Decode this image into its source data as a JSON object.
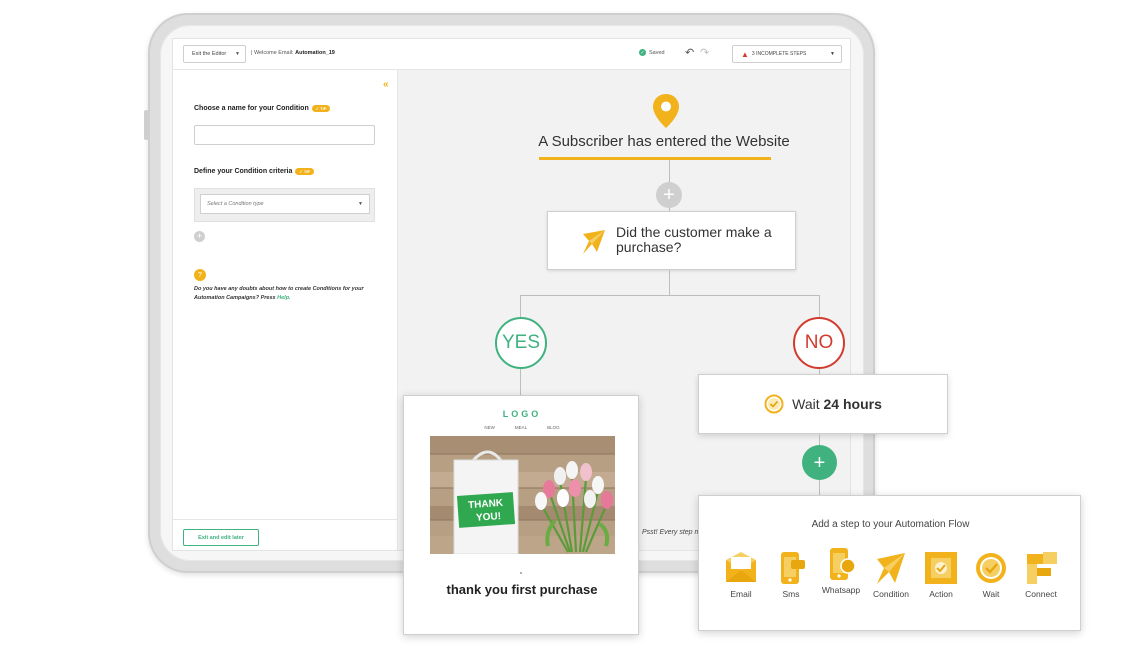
{
  "topbar": {
    "exit_editor": "Exit the Editor",
    "breadcrumb_prefix": "| Welcome Email: ",
    "breadcrumb_name": "Automation_19",
    "saved": "Saved",
    "incomplete_steps": "3 INCOMPLETE STEPS"
  },
  "leftpanel": {
    "name_label": "Choose a name for your Condition",
    "tip": "TIP",
    "criteria_label": "Define your Condition criteria",
    "select_placeholder": "Select a Condition type",
    "help_text": "Do you have any doubts about how to create Conditions for your Automation Campaigns? Press ",
    "help_link": "Help.",
    "exit_later": "Exit and edit later"
  },
  "flow": {
    "trigger": "A Subscriber has entered the Website",
    "condition": "Did the customer make a purchase?",
    "yes": "YES",
    "no": "NO",
    "wait_prefix": "Wait ",
    "wait_value": "24 hours",
    "psst": "Psst! Every step ma"
  },
  "email_card": {
    "logo": "LOGO",
    "nav": [
      "NEW",
      "MEAL",
      "BLOG"
    ],
    "bag_text_1": "THANK",
    "bag_text_2": "YOU!",
    "title": "thank you first purchase"
  },
  "add_step": {
    "title": "Add a step to your Automation Flow",
    "steps": [
      {
        "label": "Email",
        "icon": "email-icon"
      },
      {
        "label": "Sms",
        "icon": "sms-icon"
      },
      {
        "label": "Whatsapp",
        "icon": "whatsapp-icon"
      },
      {
        "label": "Condition",
        "icon": "condition-icon"
      },
      {
        "label": "Action",
        "icon": "action-icon"
      },
      {
        "label": "Wait",
        "icon": "wait-icon"
      },
      {
        "label": "Connect",
        "icon": "connect-icon"
      }
    ]
  },
  "colors": {
    "accent_yellow": "#f2b21c",
    "green": "#3fb27f",
    "red": "#d23b2e"
  }
}
